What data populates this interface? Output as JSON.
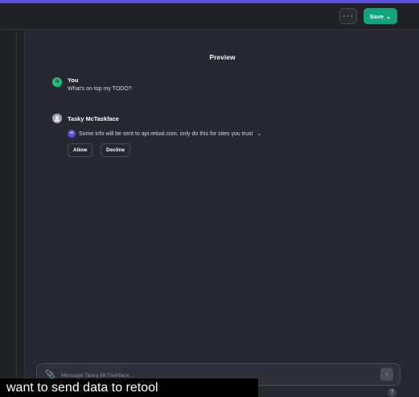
{
  "topbar": {
    "more_label": "···",
    "save_label": "Save",
    "save_chevron": "⌄"
  },
  "preview": {
    "title": "Preview",
    "user": {
      "avatar_letter": "N",
      "name": "You",
      "message": "What's on top my TODO?"
    },
    "assistant": {
      "name": "Tasky McTaskface",
      "notice_text": "Some info will be sent to api.retool.com, only do this for sites you trust",
      "notice_chevron": "⌄",
      "allow_label": "Allow",
      "decline_label": "Decline"
    }
  },
  "composer": {
    "placeholder": "Message Tasky McTaskface...",
    "attach_icon": "📎",
    "send_icon": "↑"
  },
  "help": {
    "label": "?"
  },
  "caption": {
    "text": "want to send data to retool"
  },
  "colors": {
    "accent": "#5b4fd6",
    "primary_button": "#10a37f",
    "panel_background": "#262730",
    "app_background": "#202123"
  },
  "icons": {
    "more": "more-icon",
    "attach": "paperclip-icon",
    "send": "send-icon",
    "plugin": "plugin-icon",
    "help": "help-icon"
  }
}
